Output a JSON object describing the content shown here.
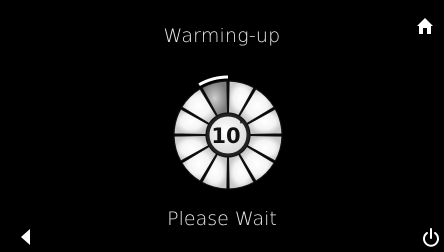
{
  "header": {
    "title": "Warming-up"
  },
  "status": {
    "message": "Please Wait"
  },
  "timer": {
    "value": "10",
    "unit_mark": "'",
    "progress_fraction": 0.083,
    "segments": 12,
    "completed_segments": 1
  },
  "navigation": {
    "home_icon": "home-icon",
    "back_icon": "back-arrow-icon",
    "power_icon": "power-icon"
  },
  "colors": {
    "background": "#000000",
    "text": "#e8e8e8",
    "segment_fill": "#f2f2f2",
    "segment_dim": "#8a8a8a",
    "progress_ring": "#ffffff"
  }
}
